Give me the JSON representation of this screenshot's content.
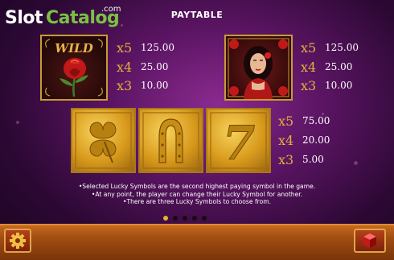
{
  "logo": {
    "slot": "Slot",
    "catalog": "Catalog",
    "com": ".com"
  },
  "title": "PAYTABLE",
  "symbols": [
    {
      "name": "wild",
      "label": "WILD",
      "pays": [
        {
          "mult": "x5",
          "value": "125.00"
        },
        {
          "mult": "x4",
          "value": "25.00"
        },
        {
          "mult": "x3",
          "value": "10.00"
        }
      ]
    },
    {
      "name": "lady",
      "pays": [
        {
          "mult": "x5",
          "value": "125.00"
        },
        {
          "mult": "x4",
          "value": "25.00"
        },
        {
          "mult": "x3",
          "value": "10.00"
        }
      ]
    },
    {
      "name": "lucky-symbols",
      "pays": [
        {
          "mult": "x5",
          "value": "75.00"
        },
        {
          "mult": "x4",
          "value": "20.00"
        },
        {
          "mult": "x3",
          "value": "5.00"
        }
      ]
    }
  ],
  "lucky_seven_glyph": "7",
  "info_lines": [
    "•Selected Lucky Symbols are the second highest paying symbol in the game.",
    "•At any point, the player can change their Lucky Symbol for another.",
    "•There are three Lucky Symbols to choose from."
  ],
  "pagination": {
    "total": 5,
    "active": 0
  },
  "colors": {
    "gold": "#e0b13a",
    "accent_green": "#7ac142",
    "bar": "#a24e12"
  },
  "icons": {
    "settings": "gear-icon",
    "info": "cube-icon"
  }
}
